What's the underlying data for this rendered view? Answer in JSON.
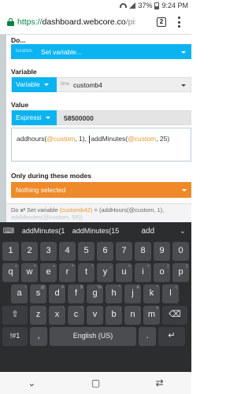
{
  "status": {
    "battery": "37%",
    "time": "9:24 PM"
  },
  "browser": {
    "url_scheme": "https://",
    "url_host": "dashboard.webcore.co",
    "url_path": "/pisto",
    "tab_count": "2"
  },
  "form": {
    "do_label": "Do...",
    "set_variable_placeholder": "Set variable...",
    "set_variable_prefix": "location",
    "variable_label": "Variable",
    "variable_type": "Variable",
    "variable_kind": "time",
    "variable_name": "customb4",
    "value_label": "Value",
    "value_type": "Expressi",
    "value_number": "58500000",
    "expression": {
      "part1": "addhours(",
      "part1_var": "@custom",
      "part1_end": ", 1), ",
      "part2": "addMinutes(",
      "part2_var": "@custom",
      "part2_end": ", 25)"
    },
    "modes_label": "Only during these modes",
    "modes_value": "Nothing selected",
    "statement": {
      "prefix": "Do",
      "x": "x²",
      "text": "Set variable",
      "var": "(customb42)",
      "assign": "= (addHours(@custom, 1),",
      "line2": "addMinutes(@custom, 58))"
    }
  },
  "keyboard": {
    "suggestions": [
      "addMinutes(1",
      "addMinutes(15",
      "add"
    ],
    "number_row": [
      "1",
      "2",
      "3",
      "4",
      "5",
      "6",
      "7",
      "8",
      "9",
      "0"
    ],
    "row1": [
      {
        "k": "q",
        "s": "+"
      },
      {
        "k": "w",
        "s": "×"
      },
      {
        "k": "e",
        "s": "÷"
      },
      {
        "k": "r",
        "s": "="
      },
      {
        "k": "t",
        "s": "/"
      },
      {
        "k": "y",
        "s": "_"
      },
      {
        "k": "u",
        "s": "<"
      },
      {
        "k": "i",
        "s": ">"
      },
      {
        "k": "o",
        "s": "["
      },
      {
        "k": "p",
        "s": "]"
      }
    ],
    "row2": [
      {
        "k": "a",
        "s": "!"
      },
      {
        "k": "s",
        "s": "@"
      },
      {
        "k": "d",
        "s": "#"
      },
      {
        "k": "f",
        "s": "$"
      },
      {
        "k": "g",
        "s": "%"
      },
      {
        "k": "h",
        "s": "^"
      },
      {
        "k": "j",
        "s": "&"
      },
      {
        "k": "k",
        "s": "*"
      },
      {
        "k": "l",
        "s": "("
      }
    ],
    "row3": [
      {
        "k": "z",
        "s": "-"
      },
      {
        "k": "x",
        "s": "'"
      },
      {
        "k": "c",
        "s": "\""
      },
      {
        "k": "v",
        "s": ":"
      },
      {
        "k": "b",
        "s": ";"
      },
      {
        "k": "n",
        "s": ","
      },
      {
        "k": "m",
        "s": "?"
      }
    ],
    "shift_icon": "⇧",
    "backspace_icon": "⌫",
    "symbols_key": "!#1",
    "comma_key": ",",
    "space_label": "English (US)",
    "period_key": ".",
    "enter_icon": "↵"
  },
  "navbar": {
    "back_icon": "⌄",
    "home_icon": "▢",
    "recents_icon": "⇄"
  }
}
